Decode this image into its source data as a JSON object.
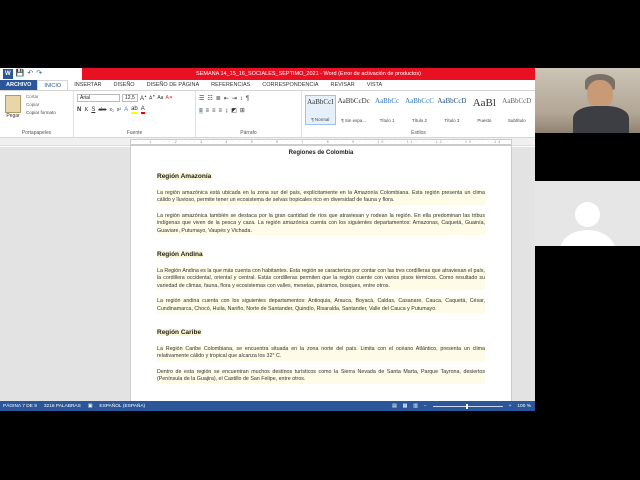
{
  "window": {
    "title": "SEMANA 14_15_16_SOCIALES_SEPTIMO_2021 - Word (Error de activación de productos)"
  },
  "quick_access": {
    "save": "💾",
    "undo": "↶",
    "redo": "↷"
  },
  "tabs": [
    {
      "label": "ARCHIVO"
    },
    {
      "label": "INICIO"
    },
    {
      "label": "INSERTAR"
    },
    {
      "label": "DISEÑO"
    },
    {
      "label": "DISEÑO DE PÁGINA"
    },
    {
      "label": "REFERENCIAS"
    },
    {
      "label": "CORRESPONDENCIA"
    },
    {
      "label": "REVISAR"
    },
    {
      "label": "VISTA"
    }
  ],
  "ribbon": {
    "clipboard": {
      "paste": "Pegar",
      "cut": "Cortar",
      "copy": "Copiar",
      "format_painter": "Copiar formato",
      "group": "Portapapeles"
    },
    "font": {
      "name": "Arial",
      "size": "12,5",
      "group": "Fuente"
    },
    "paragraph": {
      "group": "Párrafo"
    },
    "styles": {
      "group": "Estilos",
      "items": [
        {
          "preview": "AaBbCcI",
          "label": "¶ Normal"
        },
        {
          "preview": "AaBbCcDc",
          "label": "¶ Sin espa..."
        },
        {
          "preview": "AaBbCc",
          "label": "Título 1"
        },
        {
          "preview": "AaBbCcC",
          "label": "Título 2"
        },
        {
          "preview": "AaBbCcD",
          "label": "Título 3"
        },
        {
          "preview": "AaBl",
          "label": "Puesto"
        },
        {
          "preview": "AaBbCcD",
          "label": "Subtítulo"
        }
      ]
    }
  },
  "document": {
    "title": "Regiones de Colombia",
    "sections": [
      {
        "heading": "Región Amazonía",
        "paragraphs": [
          "La región amazónica está ubicada en la zona sur del país, explícitamente en la Amazonía Colombiana. Esta región presenta un clima cálido y lluvioso, permite tener un ecosistema de selvas tropicales rico en diversidad de fauna y flora.",
          "La región amazónica también se destaca por la gran cantidad de ríos que atraviesan y rodean la región. En ella predominan las tribus indígenas que viven de la pesca y caza. La región amazónica cuenta con los siguientes departamentos: Amazonas, Caquetá, Guainía, Guaviare, Putumayo, Vaupés y Vichada."
        ]
      },
      {
        "heading": "Región Andina",
        "paragraphs": [
          "La Región Andina es la que más cuenta con habitantes. Esta región se caracteriza por contar con las tres cordilleras que atraviesan el país, la cordillera occidental, oriental y central. Estás cordilleras permiten que la región cuente con varios pisos térmicos. Como resultado su variedad de climas, fauna, flora y ecosistemas con valles, mesetas, páramos, bosques, entre otros.",
          "La región andina cuenta con los siguientes departamentos: Antioquia, Arauca, Boyacá, Caldas, Casanare, Cauca, Caquetá, César, Cundinamarca, Chocó, Huila, Nariño, Norte de Santander, Quindío, Risaralda, Santander, Valle del Cauca y Putumayo."
        ]
      },
      {
        "heading": "Región Caribe",
        "paragraphs": [
          "La Región Caribe Colombiana, se encuentra situada en la zona norte del país. Limita con el océano Atlántico, presenta un clima relativamente cálido y tropical que alcanza los 32° C.",
          "Dentro de esta región se encuentran muchos destinos turísticos como la Sierra Nevada de Santa Marta, Parque Tayrona, desiertos (Península de la Guajira), el Castillo de San Felipe, entre otros."
        ]
      }
    ]
  },
  "status": {
    "page": "PÁGINA 7 DE 9",
    "words": "3216 PALABRAS",
    "language": "ESPAÑOL (ESPAÑA)",
    "zoom": "100 %"
  },
  "colors": {
    "word_blue": "#2b579a",
    "title_red": "#e81123"
  }
}
